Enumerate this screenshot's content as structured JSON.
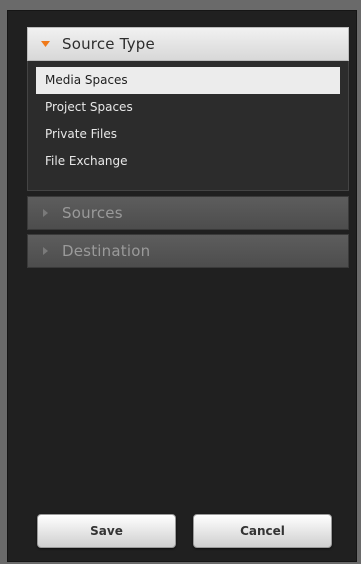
{
  "colors": {
    "accent_arrow": "#f07a1a",
    "collapsed_arrow": "#7a7a7a"
  },
  "sections": [
    {
      "title": "Source Type",
      "expanded": true,
      "icon": "caret-down-icon",
      "items": [
        {
          "label": "Media Spaces",
          "selected": true
        },
        {
          "label": "Project Spaces",
          "selected": false
        },
        {
          "label": "Private Files",
          "selected": false
        },
        {
          "label": "File Exchange",
          "selected": false
        }
      ]
    },
    {
      "title": "Sources",
      "expanded": false,
      "icon": "caret-right-icon"
    },
    {
      "title": "Destination",
      "expanded": false,
      "icon": "caret-right-icon"
    }
  ],
  "buttons": {
    "save_label": "Save",
    "cancel_label": "Cancel"
  }
}
